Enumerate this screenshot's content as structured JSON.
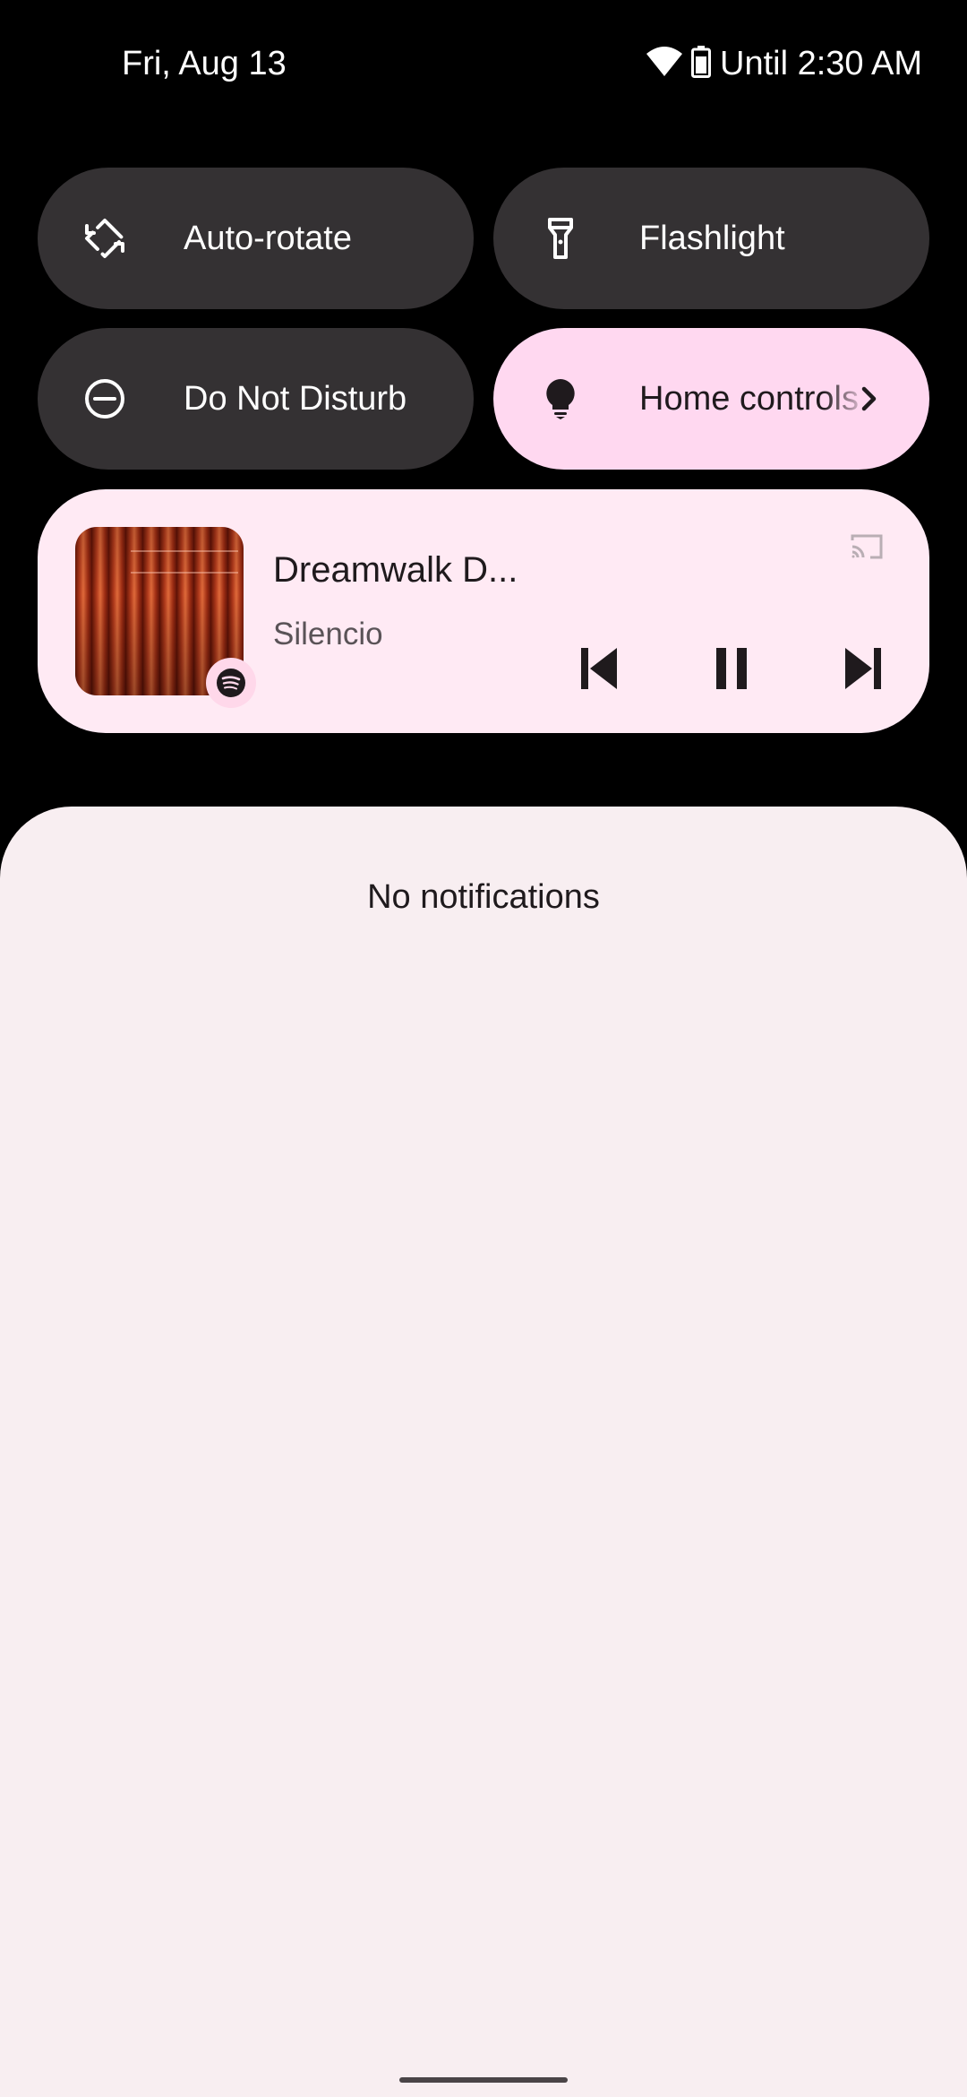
{
  "status_bar": {
    "date": "Fri, Aug 13",
    "battery_text": "Until 2:30 AM",
    "icons": [
      "wifi-icon",
      "battery-icon"
    ]
  },
  "quick_settings": {
    "tiles": [
      {
        "label": "Auto-rotate",
        "icon": "auto-rotate-icon",
        "active": false
      },
      {
        "label": "Flashlight",
        "icon": "flashlight-icon",
        "active": false
      },
      {
        "label": "Do Not Disturb",
        "icon": "do-not-disturb-icon",
        "active": false
      },
      {
        "label": "Home controls",
        "icon": "lightbulb-icon",
        "active": true
      }
    ]
  },
  "media": {
    "title": "Dreamwalk D...",
    "artist": "Silencio",
    "app_icon": "spotify-icon",
    "controls": [
      "previous-icon",
      "pause-icon",
      "next-icon"
    ]
  },
  "notifications": {
    "empty_text": "No notifications"
  },
  "colors": {
    "background": "#000000",
    "tile_inactive": "#343133",
    "tile_active": "#ffd8f0",
    "media_card": "#ffeaf4",
    "sheet": "#f8eef1"
  }
}
